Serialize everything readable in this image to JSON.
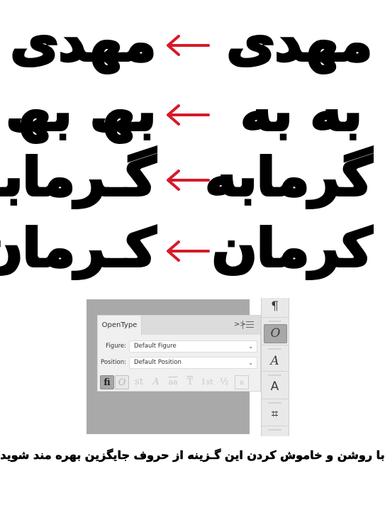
{
  "examples": [
    {
      "before": "مهدی",
      "after": "مهدی",
      "arrow_icon": "left-arrow"
    },
    {
      "before": "به به",
      "after": "بھ بھ",
      "arrow_icon": "left-arrow"
    },
    {
      "before": "گرمابه",
      "after": "گـرمابھ",
      "arrow_icon": "left-arrow"
    },
    {
      "before": "کرمان",
      "after": "کـرمان",
      "arrow_icon": "left-arrow"
    }
  ],
  "colors": {
    "arrow": "#d7192a",
    "panel_bg": "#a9a9a9",
    "text": "#000000"
  },
  "opentype_panel": {
    "tab_label": "OpenType",
    "collapse_label": ">>",
    "menu_icon": "hamburger-menu",
    "figure": {
      "label": "Figure:",
      "value": "Default Figure"
    },
    "position": {
      "label": "Position:",
      "value": "Default Position"
    },
    "glyph_buttons": [
      {
        "name": "standard-ligatures",
        "glyph": "ﬁ",
        "state": "on"
      },
      {
        "name": "contextual-alternates",
        "glyph": "O",
        "state": "outlined"
      },
      {
        "name": "discretionary-ligatures",
        "glyph": "st",
        "state": "disabled"
      },
      {
        "name": "swash",
        "glyph": "A",
        "state": "disabled"
      },
      {
        "name": "stylistic-alternates",
        "glyph": "aa",
        "state": "disabled"
      },
      {
        "name": "titling-alternates",
        "glyph": "T",
        "state": "disabled"
      },
      {
        "name": "ordinals",
        "glyph": "1st",
        "state": "disabled"
      },
      {
        "name": "fractions",
        "glyph": "½",
        "state": "disabled"
      },
      {
        "name": "stylistic-sets",
        "glyph": "a",
        "state": "disabled"
      }
    ]
  },
  "toolstrip": [
    {
      "name": "paragraph",
      "glyph": "¶",
      "active": false
    },
    {
      "name": "opentype",
      "glyph": "O",
      "active": true
    },
    {
      "name": "glyphs",
      "glyph": "A",
      "active": false
    },
    {
      "name": "character-styles",
      "glyph": "A",
      "active": false
    },
    {
      "name": "transform",
      "glyph": "⌗",
      "active": false
    }
  ],
  "caption": "با روشن و خاموش کردن این گـزینه از حروف جایگزین بهره مند شوید"
}
